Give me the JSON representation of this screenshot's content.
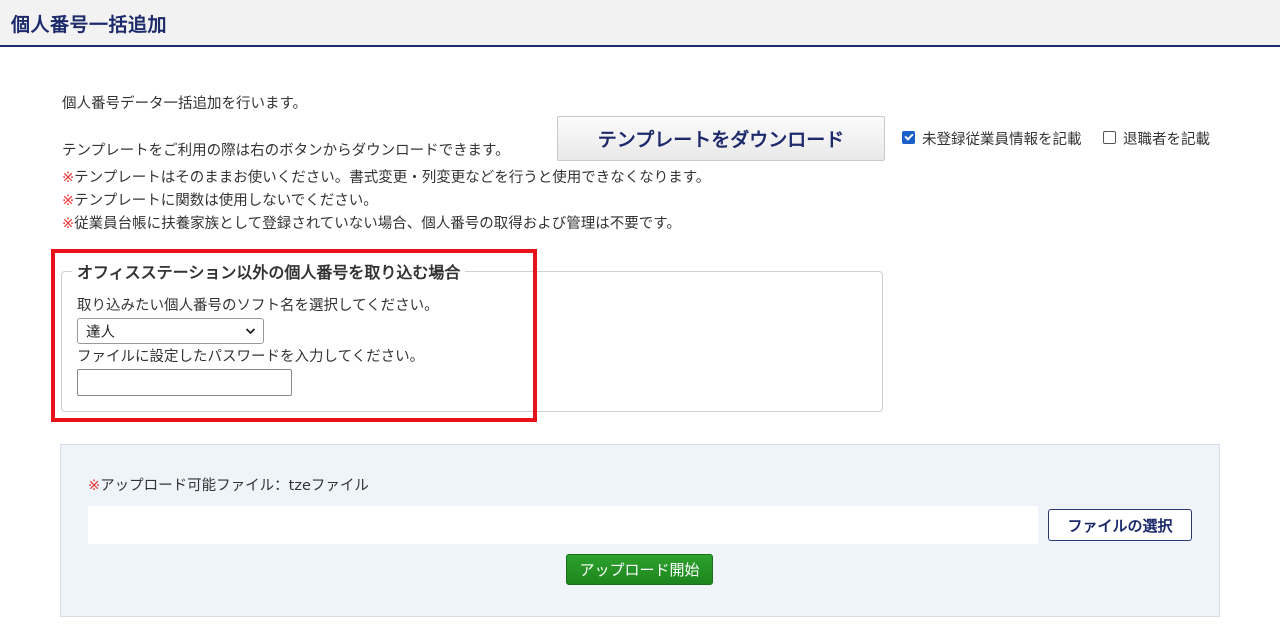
{
  "header": {
    "title": "個人番号一括追加"
  },
  "intro": {
    "line1": "個人番号データ一括追加を行います。",
    "line2": "テンプレートをご利用の際は右のボタンからダウンロードできます。",
    "notes": [
      "テンプレートはそのままお使いください。書式変更・列変更などを行うと使用できなくなります。",
      "テンプレートに関数は使用しないでください。",
      "従業員台帳に扶養家族として登録されていない場合、個人番号の取得および管理は不要です。"
    ],
    "note_mark": "※"
  },
  "download": {
    "button_label": "テンプレートをダウンロード",
    "options": [
      {
        "label": "未登録従業員情報を記載",
        "checked": true
      },
      {
        "label": "退職者を記載",
        "checked": false
      }
    ]
  },
  "office_station": {
    "legend": "オフィスステーション以外の個人番号を取り込む場合",
    "soft_label": "取り込みたい個人番号のソフト名を選択してください。",
    "soft_selected": "達人",
    "password_label": "ファイルに設定したパスワードを入力してください。",
    "password_value": ""
  },
  "upload": {
    "note_mark": "※",
    "note": "アップロード可能ファイル：tzeファイル",
    "file_button": "ファイルの選択",
    "start_button": "アップロード開始"
  },
  "colors": {
    "accent": "#1c2a6b",
    "warning": "#e53935",
    "highlight": "#e8121a",
    "upload_green": "#1d861d",
    "panel_bg": "#eef4fa"
  }
}
